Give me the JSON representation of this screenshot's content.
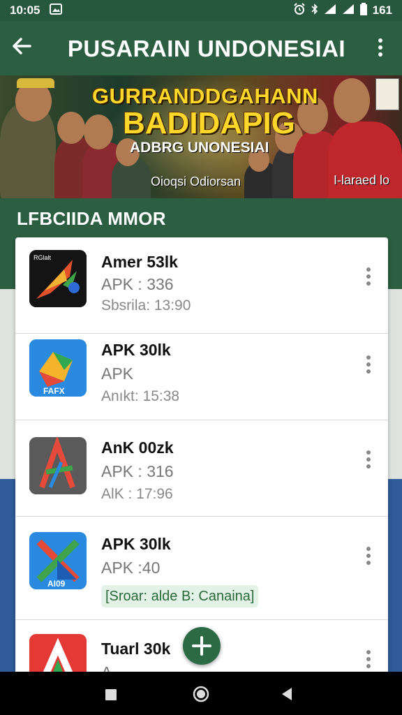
{
  "status_bar": {
    "time": "10:05",
    "battery_text": "161",
    "icons": [
      "image-icon",
      "alarm-icon",
      "bluetooth-icon",
      "signal-icon",
      "signal-icon",
      "battery-icon"
    ]
  },
  "app_bar": {
    "title": "PUSARAIN UNDONESIAI",
    "back_icon": "arrow-left-icon",
    "menu_icon": "more-vertical-icon"
  },
  "banner": {
    "line1": "GURRANDDGAHANN",
    "line2": "BADIDAPIG",
    "line3": "ADBRG UNONESIAI",
    "caption_left": "Oioqsi Odiorsan",
    "caption_right": "I-laraed lo"
  },
  "section": {
    "title": "LFBCIIDA MMOR"
  },
  "apps": [
    {
      "title": "Amer 53lk",
      "line2": "APK : 336",
      "line3": "Sbsrila: 13:90",
      "icon": "app-icon-red-black"
    },
    {
      "title": "APK 30lk",
      "line2": "APK",
      "line3": "Anıkt: 15:38",
      "icon": "app-icon-blue-green"
    },
    {
      "title": "AnK 00zk",
      "line2": "APK : 316",
      "line3": "AlK : 17:96",
      "icon": "app-icon-grey-a"
    },
    {
      "title": "APK 30lk",
      "line2": "APK :40",
      "chip": "[Sroar: alde B: Canaina]",
      "icon": "app-icon-blue-x"
    },
    {
      "title": "Tuarl 30k",
      "line2": "A",
      "icon": "app-icon-red-a"
    }
  ],
  "fab": {
    "icon": "plus-icon"
  },
  "nav_bar": {
    "icons": [
      "square-icon",
      "circle-icon",
      "triangle-back-icon"
    ]
  },
  "colors": {
    "primary": "#2c5e41",
    "status_bar": "#27573c",
    "fab": "#2c6a45",
    "blue_bg": "#2f5b98"
  }
}
